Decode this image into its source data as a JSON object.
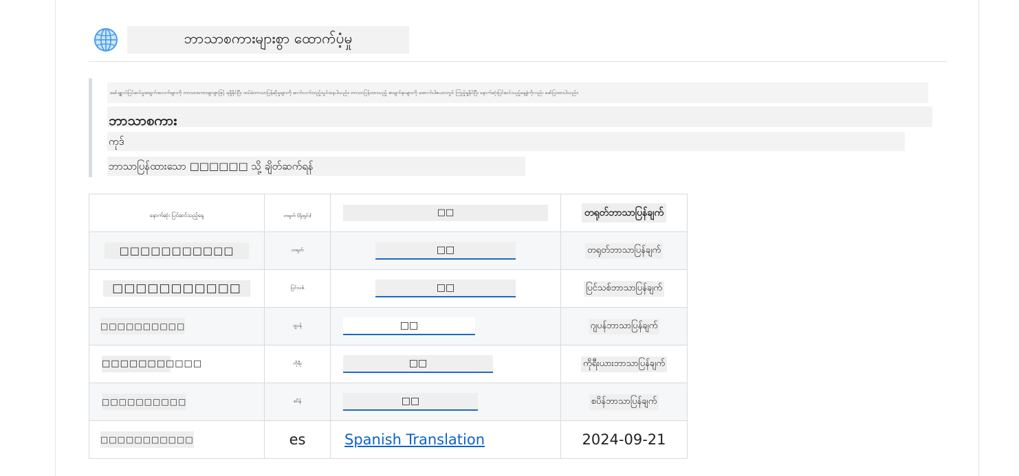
{
  "heading": {
    "icon": "globe-icon",
    "title": "ဘာသာစကားများစွာ ထောက်ပံ့မှု"
  },
  "note": {
    "intro": "မော်ဒျူးလ်ပြင်ဆင်မှုအချက်အလက်များကို ဘာသာစကားများစွာဖြင့် ရရှိနိုင်ပြီး ထပ်မံဘာသာပြန်ဆိုမှုများကို ဆက်လက်ထည့်သွင်းနေပါသည်။ ဘာသာပြန်ထားသည့် စာမျက်နှာများကို အောက်ပါဇယားတွင် ကြည့်ရှုနိုင်ပြီး နောက်ဆုံးပြင်ဆင်သည့်နေ့စွဲကိုလည်း ဖော်ပြထားပါသည်။",
    "language_label": "ဘာသာစကား",
    "code_label": "ကုဒ်",
    "link_label": "ဘာသာပြန်ထားသော □□□□□□ သို့ ချိတ်ဆက်ရန်"
  },
  "table": {
    "headers": [
      "နောက်ဆုံး ပြင်ဆင်သည့်နေ့",
      "တရုတ် (ရိုးရှင်း)",
      "□□",
      "တရုတ်ဘာသာပြန်ချက်"
    ],
    "rows": [
      {
        "name": "□□□□□□□□□□□",
        "code": "တရုတ်",
        "link": "□□",
        "date": "တရုတ်ဘာသာပြန်ချက်"
      },
      {
        "name": "□□□□□□□□□□□",
        "code": "ပြင်သစ်",
        "link": "□□",
        "date": "ပြင်သစ်ဘာသာပြန်ချက်"
      },
      {
        "name": "□□□□□□□□□□",
        "code": "ဂျပန်",
        "link": "□□",
        "date": "ဂျပန်ဘာသာပြန်ချက်"
      },
      {
        "name": "□□□□□□□□□□□",
        "code": "ကိုရီး",
        "link": "□□",
        "date": "ကိုရီးယားဘာသာပြန်ချက်"
      },
      {
        "name": "□□□□□□□□□□",
        "code": "စပိန်",
        "link": "□□",
        "date": "စပိန်ဘာသာပြန်ချက်"
      },
      {
        "name": "□□□□□□□□□□□",
        "code": "es",
        "link": "Spanish Translation",
        "date": "2024-09-21"
      }
    ]
  },
  "colors": {
    "link": "#0b62c9",
    "border": "#d6d9dc",
    "note_bar": "#d8dde2"
  }
}
